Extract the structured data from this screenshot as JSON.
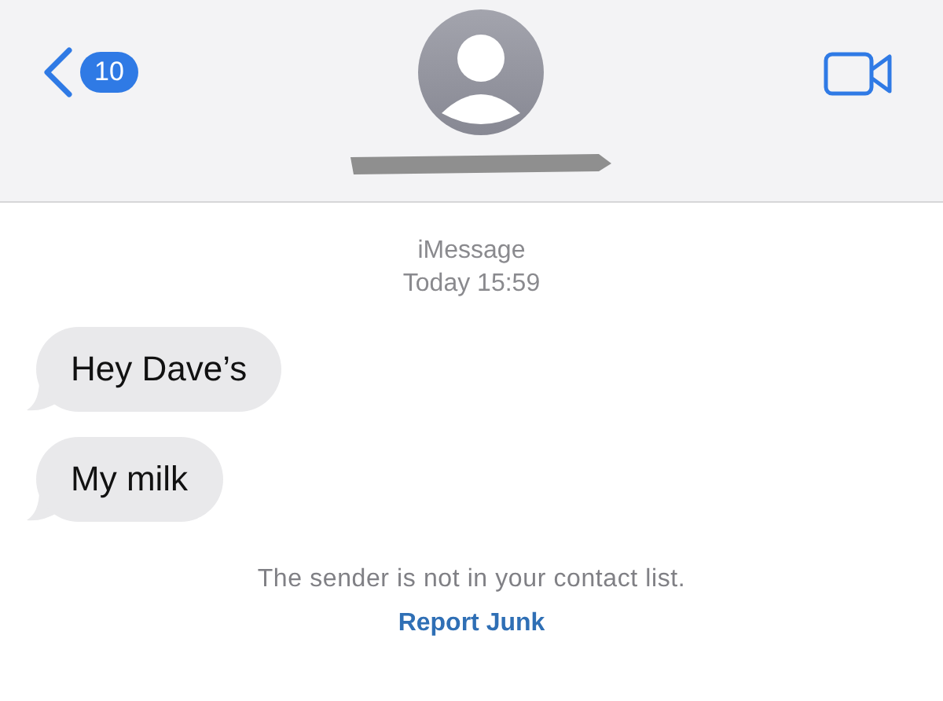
{
  "header": {
    "back_badge": "10"
  },
  "thread": {
    "service": "iMessage",
    "timestamp": "Today 15:59",
    "messages": [
      {
        "text": "Hey Dave’s",
        "kind": "incoming"
      },
      {
        "text": "My milk",
        "kind": "incoming"
      }
    ]
  },
  "notice": {
    "text": "The sender is not in your contact list.",
    "link": "Report Junk"
  }
}
